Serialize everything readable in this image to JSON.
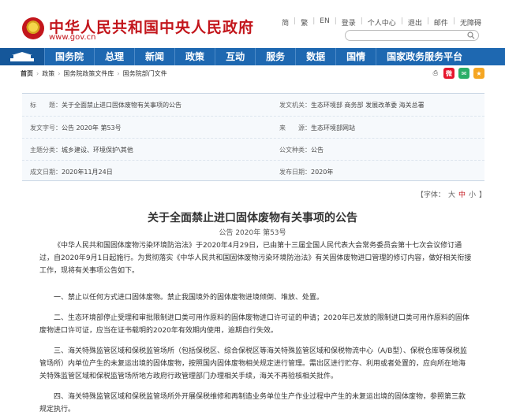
{
  "header": {
    "site_name": "中华人民共和国中央人民政府",
    "site_url": "www.gov.cn",
    "top_links": [
      "简",
      "繁",
      "EN",
      "登录",
      "个人中心",
      "退出",
      "邮件",
      "无障碍"
    ]
  },
  "nav": {
    "items": [
      "国务院",
      "总理",
      "新闻",
      "政策",
      "互动",
      "服务",
      "数据",
      "国情",
      "国家政务服务平台"
    ]
  },
  "breadcrumb": [
    "首页",
    "政策",
    "国务院政策文件库",
    "国务院部门文件"
  ],
  "share": {
    "label": "分享",
    "icons": [
      "weibo-icon",
      "wechat-icon",
      "qzone-icon"
    ]
  },
  "meta": {
    "index_label": "标　　题：",
    "index_value": "关于全面禁止进口固体废物有关事项的公告",
    "issuer_label": "发文机关：",
    "issuer_value": "生态环境部 商务部 发展改革委 海关总署",
    "docno_label": "发文字号：",
    "docno_value": "公告 2020年 第53号",
    "source_label": "来　　源：",
    "source_value": "生态环境部网站",
    "category_label": "主题分类：",
    "category_value": "城乡建设、环境保护\\其他",
    "doctype_label": "公文种类：",
    "doctype_value": "公告",
    "date_label": "成文日期：",
    "date_value": "2020年11月24日",
    "pubdate_label": "发布日期：",
    "pubdate_value": "2020年"
  },
  "fontsize": {
    "label": "【字体：",
    "large": "大",
    "medium": "中",
    "small": "小",
    "close": "】"
  },
  "article": {
    "title": "关于全面禁止进口固体废物有关事项的公告",
    "docno": "公告 2020年 第53号",
    "p1": "《中华人民共和国固体废物污染环境防治法》于2020年4月29日，已由第十三届全国人民代表大会常务委员会第十七次会议修订通过，自2020年9月1日起施行。为贯彻落实《中华人民共和国固体废物污染环境防治法》有关固体废物进口管理的修订内容，做好相关衔接工作，现将有关事项公告如下。",
    "p2": "一、禁止以任何方式进口固体废物。禁止我国境外的固体废物进境倾倒、堆放、处置。",
    "p3": "二、生态环境部停止受理和审批限制进口类可用作原料的固体废物进口许可证的申请；2020年已发放的限制进口类可用作原料的固体废物进口许可证，应当在证书载明的2020年有效期内使用，逾期自行失效。",
    "p4": "三、海关特殊监管区域和保税监管场所（包括保税区、综合保税区等海关特殊监管区域和保税物流中心（A/B型）、保税仓库等保税监管场所）内单位产生的未复运出境的固体废物，按照国内固体废物相关规定进行管理。需出区进行贮存、利用或者处置的，应向所在地海关特殊监管区域和保税监管场所地方政府行政管理部门办理相关手续，海关不再验核相关批件。",
    "p5": "四、海关特殊监管区域和保税监管场所外开展保税维修和再制造业务单位生产作业过程中产生的未复运出境的固体废物，参照第三款规定执行。"
  }
}
